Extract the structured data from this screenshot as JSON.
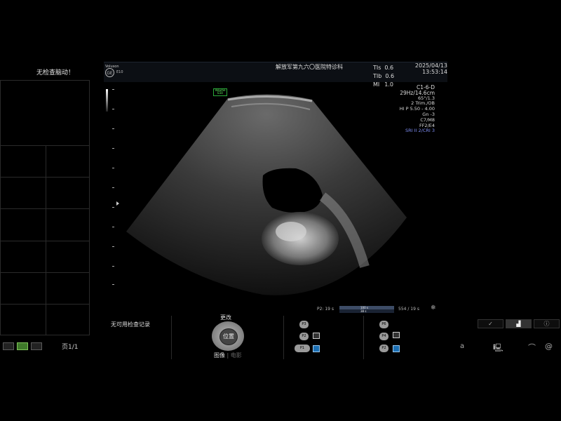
{
  "left_panel": {
    "message": "无检查脑动！",
    "page_indicator": "页1/1"
  },
  "header": {
    "logo_text": "Voluson",
    "brand_badge": "GE",
    "model": "E10",
    "hospital": "解放军第九六〇医院特诊科",
    "indices": [
      {
        "label": "TIs",
        "value": "0.6"
      },
      {
        "label": "TIb",
        "value": "0.6"
      },
      {
        "label": "MI",
        "value": "1.0"
      }
    ],
    "date": "2025/04/13",
    "time": "13:53:14"
  },
  "params": {
    "probe": "C1-6-D",
    "freq_depth": "29Hz/14.6cm",
    "angle": "65°/1.3",
    "preset": "2 Trim./OB",
    "harmonic": "HI P 5.50 - 4.00",
    "gain": "Gn  -3",
    "map": "C7/M8",
    "filter": "FF2/E4",
    "sri": "SRI II 2/CRI 3"
  },
  "image": {
    "vol_badge_line1": "Volume",
    "vol_badge_line2": "E10"
  },
  "cine": {
    "label": "P2:  19 s",
    "bar_top": "100 s",
    "bar_bottom": "38 s",
    "right": "554 / 19 s"
  },
  "controls": {
    "no_records": "无可用检查记录",
    "change": "更改",
    "position": "位置",
    "image": "图像",
    "movie": "电影",
    "p_left": [
      "P3",
      "P2",
      "P1"
    ],
    "p_right": [
      "P6",
      "P4",
      "P2"
    ]
  },
  "right_tabs": [
    "✓",
    "▟",
    "ⓘ"
  ],
  "status_icons": {
    "a": "a"
  }
}
